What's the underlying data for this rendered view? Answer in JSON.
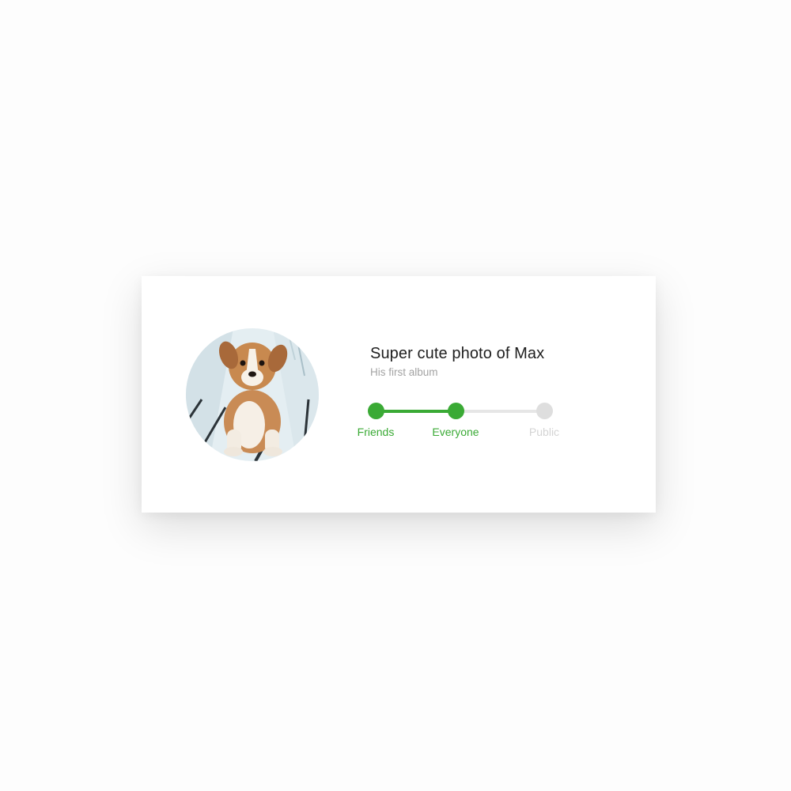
{
  "card": {
    "title": "Super cute photo of Max",
    "subtitle": "His first album"
  },
  "photo": {
    "subject": "puppy-photo"
  },
  "privacy_stepper": {
    "steps": [
      {
        "label": "Friends",
        "active": true
      },
      {
        "label": "Everyone",
        "active": true
      },
      {
        "label": "Public",
        "active": false
      }
    ],
    "selected_index": 1
  },
  "colors": {
    "accent": "#3aaa35",
    "inactive": "#dedede",
    "title": "#1e1e1e",
    "subtitle": "#a3a3a3"
  }
}
